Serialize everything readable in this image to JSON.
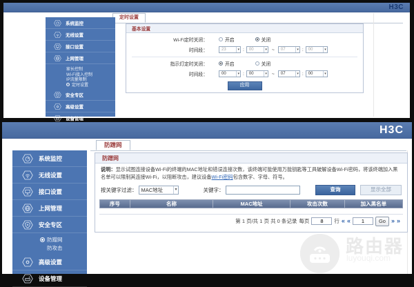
{
  "colors": {
    "header_blue": "#4f72a8",
    "sidebar_blue": "#4c75b2",
    "tab_text_maroon": "#9c4040",
    "link_blue": "#2d64b5",
    "button_blue": "#3e68a2",
    "table_header_blue": "#5a6d90",
    "logo_navy": "#17386f"
  },
  "top_page": {
    "logo": "H3C",
    "tab": "定时设置",
    "sidebar": {
      "items": [
        {
          "label": "系统监控",
          "icon": "gauge-icon"
        },
        {
          "label": "无线设置",
          "icon": "wifi-icon"
        },
        {
          "label": "接口设置",
          "icon": "port-icon"
        },
        {
          "label": "上网管理",
          "icon": "globe-icon"
        },
        {
          "label": "安全专区",
          "icon": "shield-icon"
        },
        {
          "label": "高级设置",
          "icon": "gear-icon"
        },
        {
          "label": "设备管理",
          "icon": "router-icon"
        }
      ],
      "submenu_parent": "上网管理",
      "submenu": [
        {
          "label": "家长控制",
          "active": false
        },
        {
          "label": "Wi-Fi接入控制",
          "active": false
        },
        {
          "label": "IP流量限制",
          "active": false
        },
        {
          "label": "定时设置",
          "active": true
        }
      ]
    },
    "panel": {
      "title": "基本设置",
      "wifi_row": {
        "label": "Wi-Fi定时关闭：",
        "option_on": "开启",
        "option_off": "关闭",
        "selected": "关闭"
      },
      "wifi_time": {
        "label": "时间段：",
        "hour_from": "23",
        "min_from": "00",
        "hour_to": "07",
        "min_to": "00",
        "disabled": true
      },
      "led_row": {
        "label": "指示灯定时关闭：",
        "option_on": "开启",
        "option_off": "关闭",
        "selected": "开启"
      },
      "led_time": {
        "label": "时间段：",
        "hour_from": "00",
        "min_from": "00",
        "hour_to": "07",
        "min_to": "00",
        "disabled": false
      },
      "sep": {
        "colon": ":",
        "tilde": "~"
      },
      "apply_button": "应用"
    }
  },
  "bottom_page": {
    "logo": "H3C",
    "tab": "防蹭网",
    "sidebar": {
      "items": [
        {
          "label": "系统监控",
          "icon": "gauge-icon"
        },
        {
          "label": "无线设置",
          "icon": "wifi-icon"
        },
        {
          "label": "接口设置",
          "icon": "port-icon"
        },
        {
          "label": "上网管理",
          "icon": "globe-icon"
        },
        {
          "label": "安全专区",
          "icon": "shield-icon"
        },
        {
          "label": "高级设置",
          "icon": "gear-icon"
        },
        {
          "label": "设备管理",
          "icon": "router-icon"
        }
      ],
      "submenu_parent": "安全专区",
      "submenu": [
        {
          "label": "防蹭网",
          "active": true
        },
        {
          "label": "防攻击",
          "active": false
        }
      ]
    },
    "panel": {
      "title": "防蹭网",
      "description": {
        "prefix": "说明：",
        "text_before_link": "显示试图连接设备Wi-Fi的终端的MAC地址和错误连接次数，该终端可能使用万能钥匙等工具破解设备Wi-Fi密码，将该终端加入黑名单可以限制其连接Wi-Fi，以阻断攻击，建议设备",
        "link": "Wi-Fi密码",
        "text_after_link": "包含数字、字母、符号。"
      },
      "filter": {
        "filter_label": "按关键字过滤：",
        "filter_value": "MAC地址",
        "keyword_label": "关键字：",
        "keyword_value": "",
        "query_button": "查询",
        "show_all_button": "显示全部"
      },
      "table": {
        "headers": [
          "序号",
          "名称",
          "MAC地址",
          "攻击次数",
          "加入黑名单"
        ],
        "rows": []
      },
      "pagination": {
        "info": "第 1 页/共 1 页 共 0 条记录",
        "per_page_label": "每页",
        "per_page_value": "8",
        "rows_label": "行",
        "first_icon": "«",
        "prev_icon": "«",
        "page_value": "1",
        "go_button": "Go",
        "next_icon": "»",
        "last_icon": "»"
      }
    },
    "watermark": {
      "title": "路由器",
      "domain": "luyouqi.com"
    }
  }
}
